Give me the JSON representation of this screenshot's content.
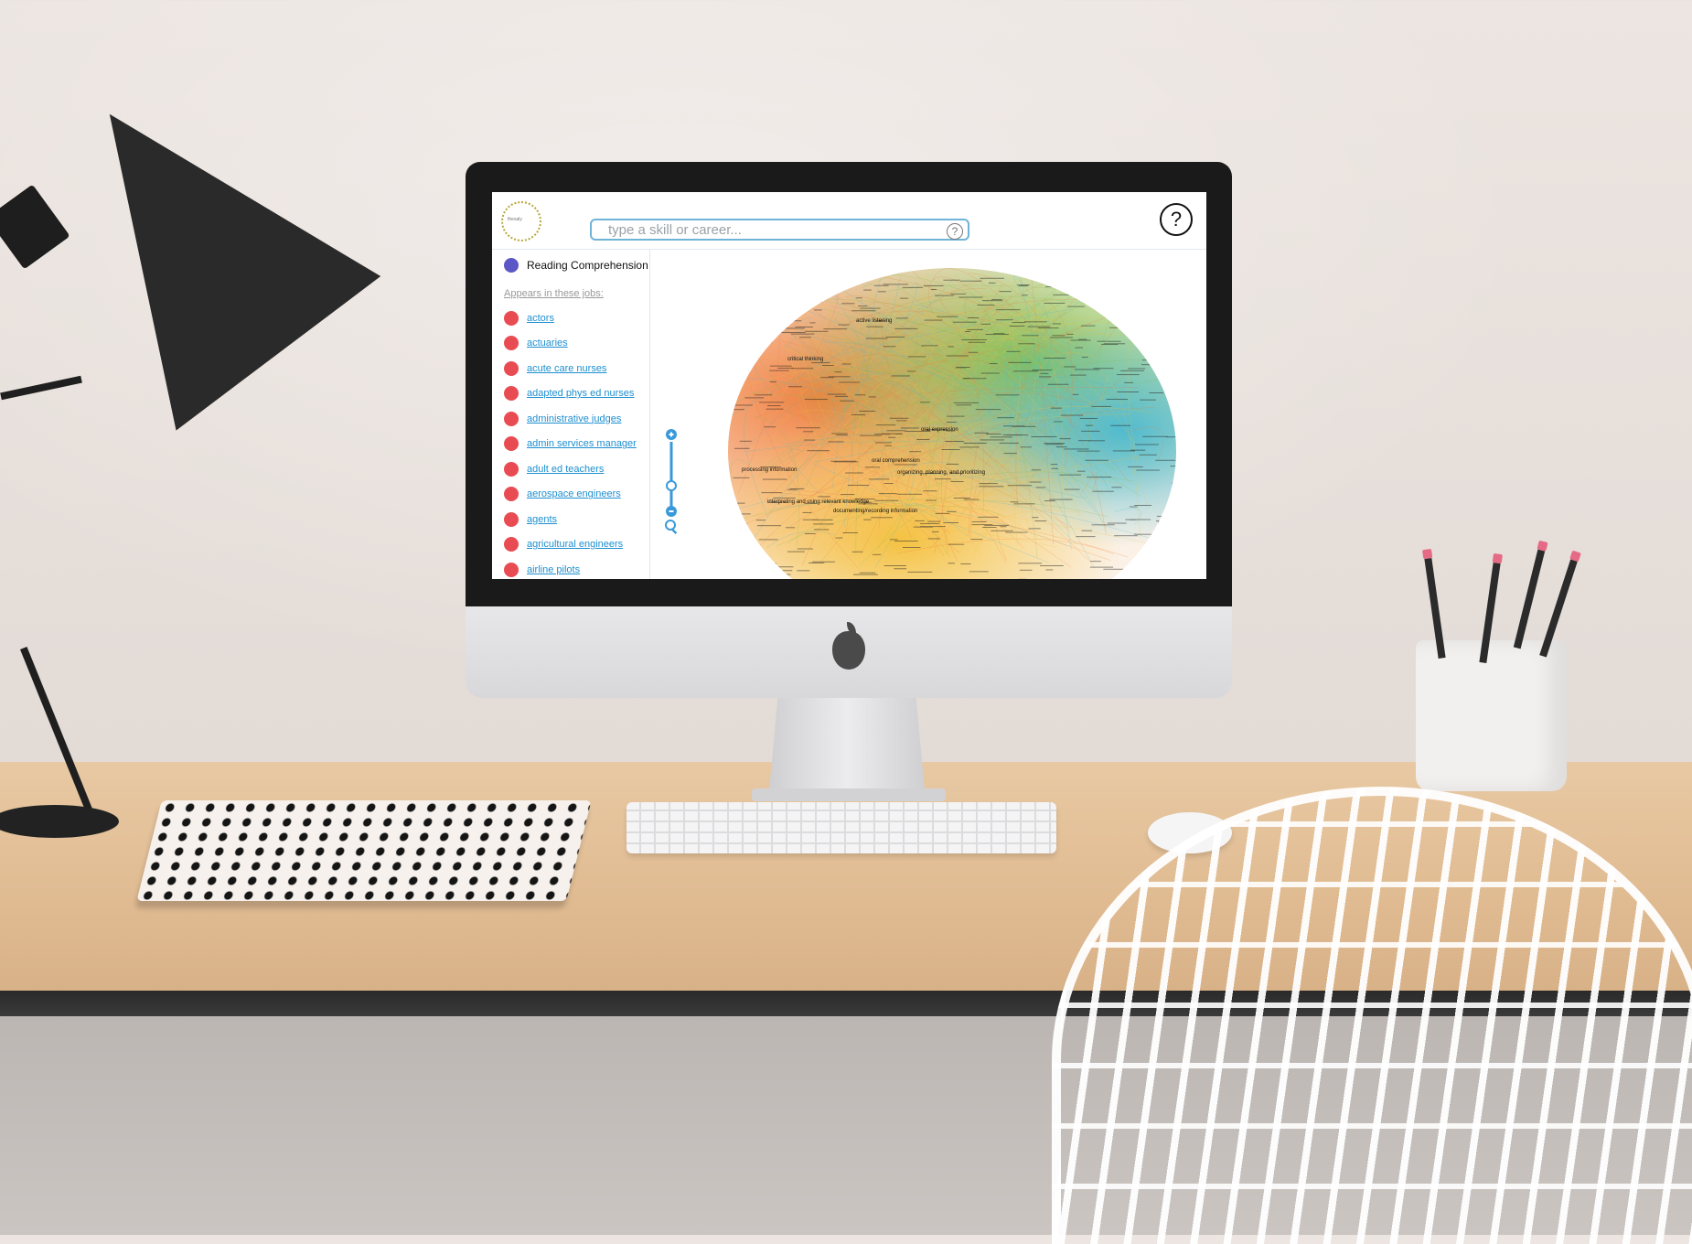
{
  "app": {
    "logo_text": "thesaly",
    "search": {
      "placeholder": "type a skill or career..."
    },
    "help_symbol": "?"
  },
  "sidebar": {
    "selected_skill": {
      "label": "Reading Comprehension",
      "color": "#5b57c7"
    },
    "jobs_heading": "Appears in these jobs:",
    "job_dot_color": "#e84c52",
    "jobs": [
      "actors",
      "actuaries",
      "acute care nurses",
      "adapted phys ed nurses",
      "administrative judges",
      "admin services manager",
      "adult ed teachers",
      "aerospace engineers",
      "agents",
      "agricultural engineers",
      "airline pilots"
    ]
  },
  "graph": {
    "labels": [
      "oral comprehension",
      "organizing, planning, and prioritizing",
      "processing information",
      "interpreting and using relevant knowledge",
      "documenting/recording information",
      "critical thinking",
      "active listening",
      "oral expression"
    ],
    "colors": [
      "#f07c3a",
      "#7cbf4a",
      "#4bb9d1",
      "#f4c13c"
    ]
  },
  "zoom_controls": {
    "accent": "#3a9ad9"
  }
}
